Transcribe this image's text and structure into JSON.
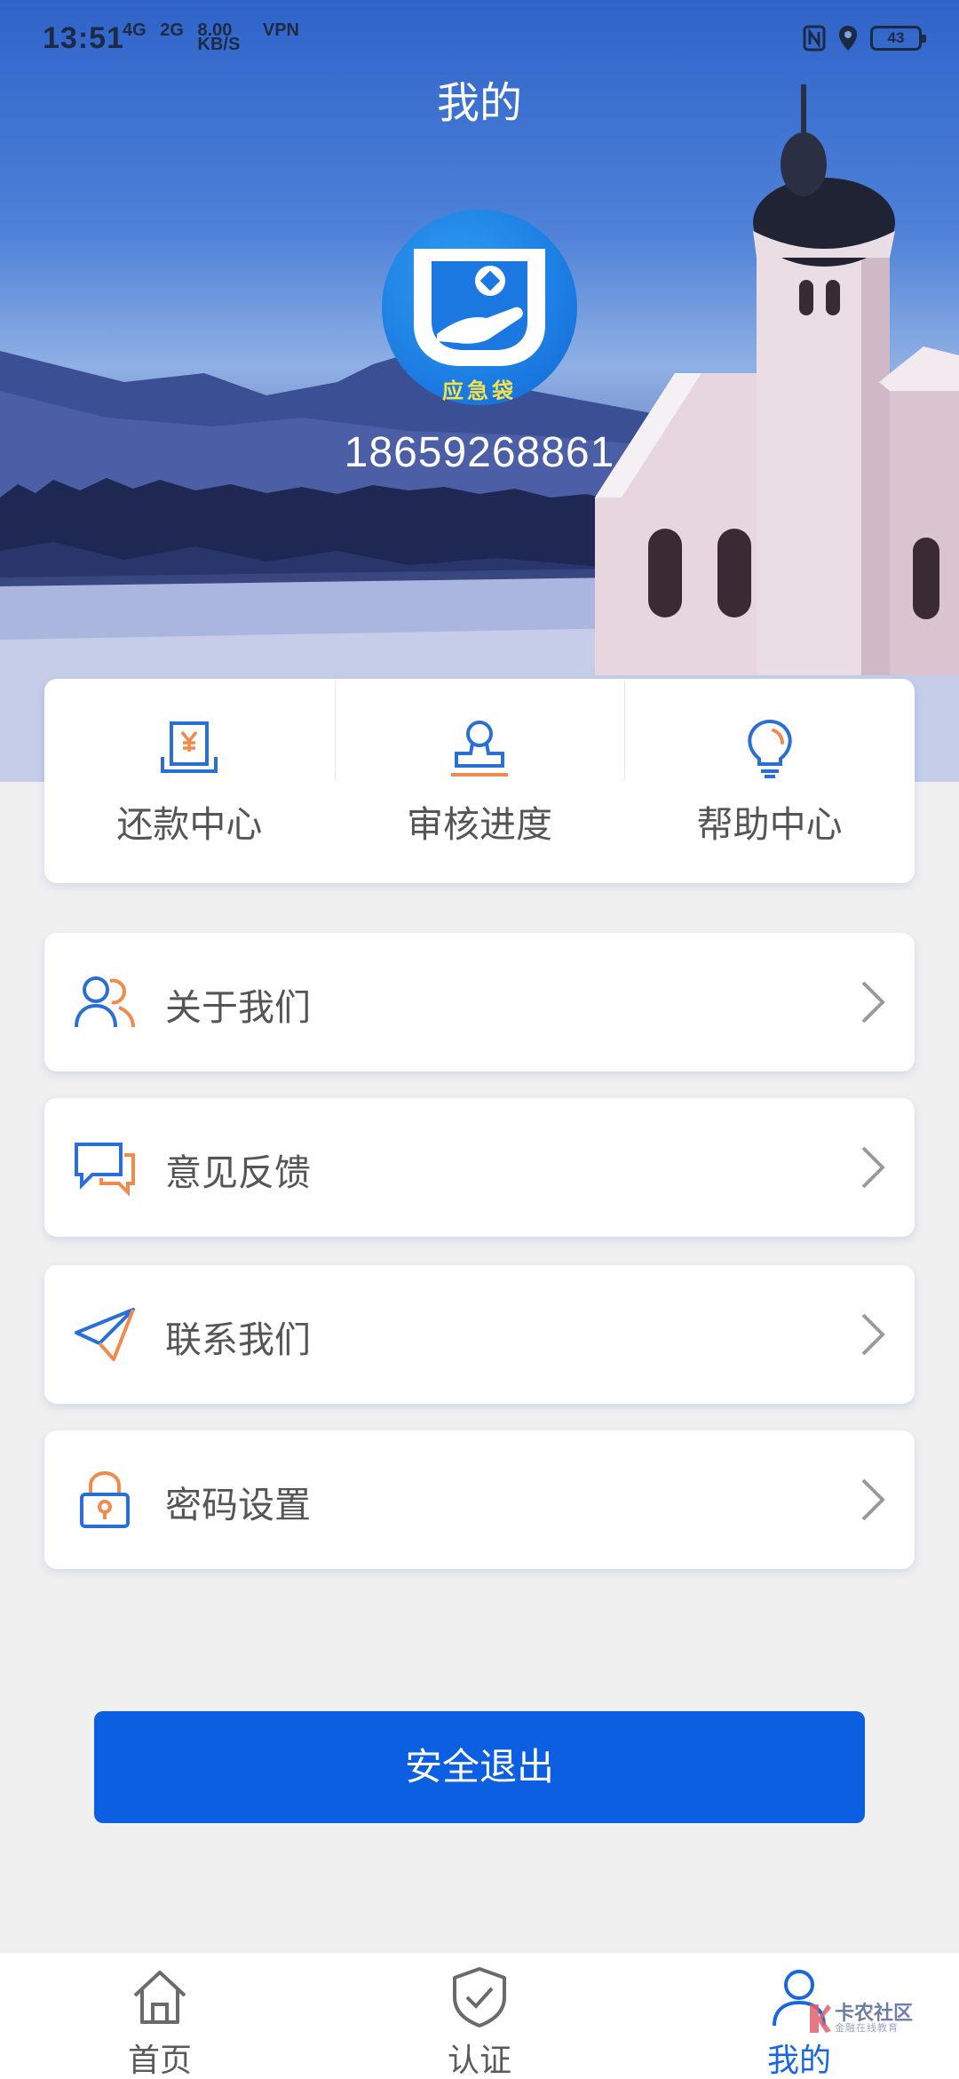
{
  "status_bar": {
    "time": "13:51",
    "network_1": "4G",
    "network_2": "2G",
    "speed_value": "8.00",
    "speed_unit": "KB/S",
    "vpn": "VPN",
    "battery": "43"
  },
  "header": {
    "title": "我的"
  },
  "profile": {
    "avatar_label": "应急袋",
    "phone": "18659268861"
  },
  "quick_actions": [
    {
      "label": "还款中心",
      "icon": "repayment-receipt-icon"
    },
    {
      "label": "审核进度",
      "icon": "stamp-icon"
    },
    {
      "label": "帮助中心",
      "icon": "lightbulb-icon"
    }
  ],
  "menu": [
    {
      "label": "关于我们",
      "icon": "users-icon"
    },
    {
      "label": "意见反馈",
      "icon": "chat-bubbles-icon"
    },
    {
      "label": "联系我们",
      "icon": "paper-plane-icon"
    },
    {
      "label": "密码设置",
      "icon": "lock-icon"
    }
  ],
  "logout_label": "安全退出",
  "tabs": [
    {
      "label": "首页",
      "icon": "home-icon"
    },
    {
      "label": "认证",
      "icon": "shield-check-icon"
    },
    {
      "label": "我的",
      "icon": "user-icon",
      "active": true
    }
  ],
  "watermark": {
    "title": "卡农社区",
    "subtitle": "金融在线教育"
  },
  "colors": {
    "primary_blue": "#0c5fe0",
    "icon_blue": "#2a6fd6",
    "icon_orange": "#f08b4f",
    "active_tab": "#1a66e0"
  }
}
